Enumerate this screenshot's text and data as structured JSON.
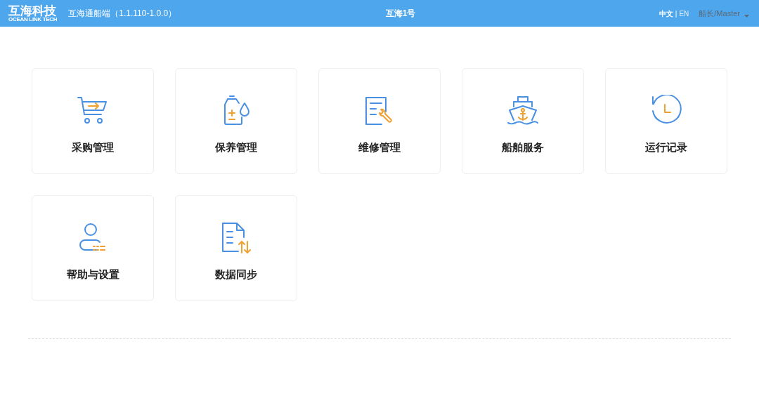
{
  "header": {
    "logo_name": "互海科技",
    "logo_tagline": "OCEAN LINK TECH",
    "app_title": "互海通船端（1.1.110-1.0.0）",
    "vessel": "互海1号",
    "languages": [
      {
        "label": "中文",
        "selected": true
      },
      {
        "label": "EN",
        "selected": false
      }
    ],
    "language_separator": "|",
    "user": "船长/Master"
  },
  "tiles": [
    {
      "kind": "cart",
      "label": "采购管理"
    },
    {
      "kind": "bottle",
      "label": "保养管理"
    },
    {
      "kind": "repair",
      "label": "维修管理"
    },
    {
      "kind": "ship",
      "label": "船舶服务"
    },
    {
      "kind": "history",
      "label": "运行记录"
    },
    {
      "kind": "user",
      "label": "帮助与设置"
    },
    {
      "kind": "sync",
      "label": "数据同步"
    }
  ]
}
